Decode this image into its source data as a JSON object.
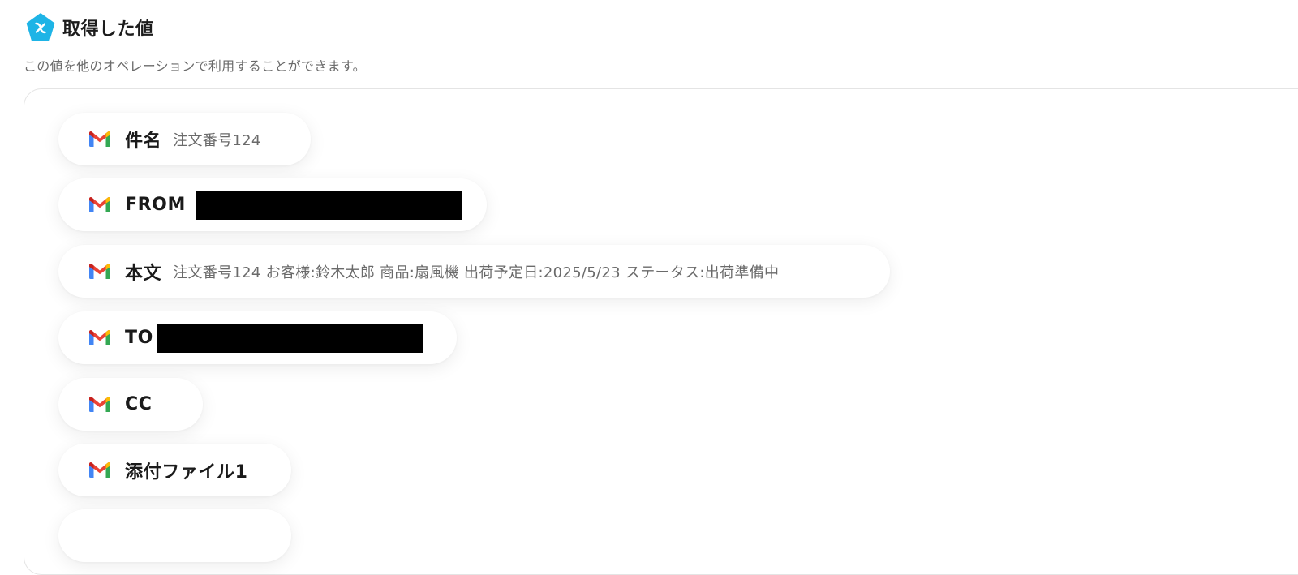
{
  "header": {
    "title": "取得した値",
    "description": "この値を他のオペレーションで利用することができます。",
    "icon": "variable-icon",
    "accent_color": "#1EB4E6"
  },
  "outputs": [
    {
      "icon": "gmail-icon",
      "label": "件名",
      "value": "注文番号124",
      "redacted": false
    },
    {
      "icon": "gmail-icon",
      "label": "FROM",
      "value": "",
      "redacted": true
    },
    {
      "icon": "gmail-icon",
      "label": "本文",
      "value": "注文番号124 お客様:鈴木太郎 商品:扇風機 出荷予定日:2025/5/23 ステータス:出荷準備中",
      "redacted": false
    },
    {
      "icon": "gmail-icon",
      "label": "TO",
      "value": "",
      "redacted": true
    },
    {
      "icon": "gmail-icon",
      "label": "CC",
      "value": "",
      "redacted": false
    },
    {
      "icon": "gmail-icon",
      "label": "添付ファイル1",
      "value": "",
      "redacted": false
    }
  ]
}
